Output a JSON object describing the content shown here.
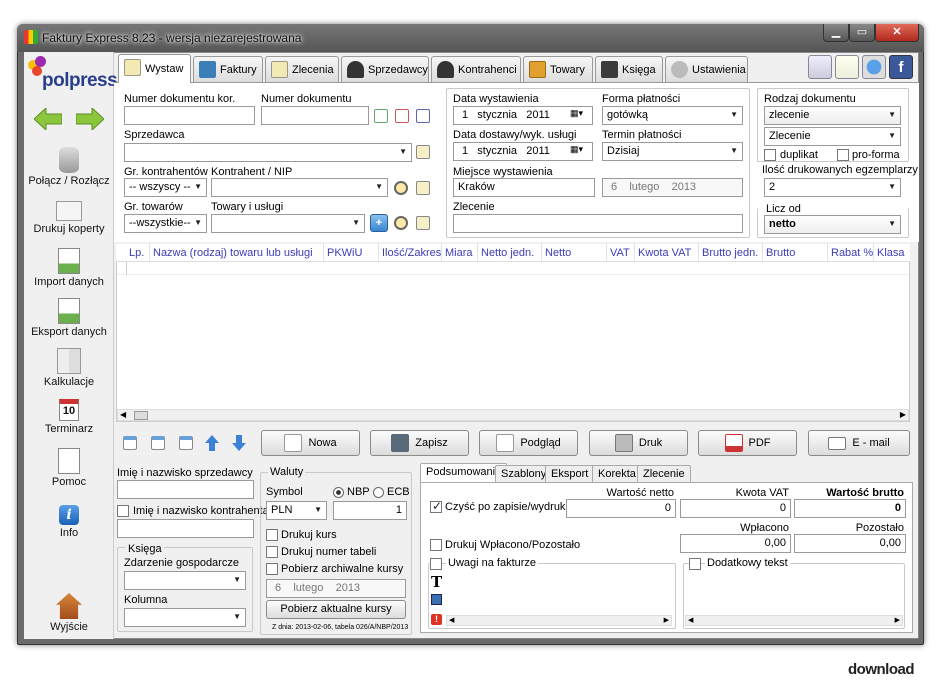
{
  "window": {
    "title": "Faktury Express 8.23 - wersja niezarejestrowana"
  },
  "brand": {
    "logo_text": "polpress"
  },
  "sidebar": {
    "items": [
      {
        "label": "Połącz / Rozłącz",
        "icon": "database-icon"
      },
      {
        "label": "Drukuj koperty",
        "icon": "envelope-icon"
      },
      {
        "label": "Import danych",
        "icon": "import-icon"
      },
      {
        "label": "Eksport danych",
        "icon": "export-icon"
      },
      {
        "label": "Kalkulacje",
        "icon": "calculator-icon"
      },
      {
        "label": "Terminarz",
        "icon": "calendar-icon",
        "badge": "10"
      },
      {
        "label": "Pomoc",
        "icon": "help-icon"
      },
      {
        "label": "Info",
        "icon": "info-icon",
        "glyph": "i"
      },
      {
        "label": "Wyjście",
        "icon": "exit-icon"
      }
    ]
  },
  "tabs": [
    {
      "label": "Wystaw"
    },
    {
      "label": "Faktury"
    },
    {
      "label": "Zlecenia"
    },
    {
      "label": "Sprzedawcy"
    },
    {
      "label": "Kontrahenci"
    },
    {
      "label": "Towary"
    },
    {
      "label": "Księga"
    },
    {
      "label": "Ustawienia"
    }
  ],
  "form": {
    "doc_kor_label": "Numer dokumentu kor.",
    "doc_num_label": "Numer dokumentu",
    "seller_label": "Sprzedawca",
    "contractor_group_label": "Gr. kontrahentów",
    "contractor_group_value": "-- wszyscy --",
    "contractor_label": "Kontrahent / NIP",
    "goods_group_label": "Gr. towarów",
    "goods_group_value": "--wszystkie--",
    "goods_label": "Towary i usługi",
    "issue_date_label": "Data wystawienia",
    "issue_date": {
      "day": "1",
      "month": "stycznia",
      "year": "2011"
    },
    "payment_form_label": "Forma płatności",
    "payment_form_value": "gotówką",
    "delivery_date_label": "Data dostawy/wyk. usługi",
    "delivery_date": {
      "day": "1",
      "month": "stycznia",
      "year": "2011"
    },
    "payment_term_label": "Termin płatności",
    "payment_term_value": "Dzisiaj",
    "place_label": "Miejsce wystawienia",
    "place_value": "Kraków",
    "place_date": {
      "day": "6",
      "month": "lutego",
      "year": "2013"
    },
    "order_label": "Zlecenie",
    "doc_type_label": "Rodzaj dokumentu",
    "doc_type_value": "zlecenie",
    "doc_type_value2": "Zlecenie",
    "duplicate_label": "duplikat",
    "proforma_label": "pro-forma",
    "copies_label": "Ilość drukowanych egzemplarzy",
    "copies_value": "2",
    "count_from_label": "Licz od",
    "count_from_value": "netto"
  },
  "grid": {
    "columns": [
      "Lp.",
      "Nazwa (rodzaj) towaru lub usługi",
      "PKWiU",
      "Ilość/Zakres",
      "Miara",
      "Netto jedn.",
      "Netto",
      "VAT",
      "Kwota VAT",
      "Brutto jedn.",
      "Brutto",
      "Rabat %",
      "Klasa"
    ]
  },
  "actions": {
    "new": "Nowa",
    "save": "Zapisz",
    "preview": "Podgląd",
    "print": "Druk",
    "pdf": "PDF",
    "email": "E - mail"
  },
  "bottom_left": {
    "seller_name_label": "Imię i nazwisko sprzedawcy",
    "contractor_name_label": "Imię i nazwisko kontrahenta",
    "book_legend": "Księga",
    "event_label": "Zdarzenie gospodarcze",
    "column_label": "Kolumna"
  },
  "currency": {
    "legend": "Waluty",
    "symbol_label": "Symbol",
    "symbol_value": "PLN",
    "nbp_label": "NBP",
    "ecb_label": "ECB",
    "rate_value": "1",
    "print_rate": "Drukuj kurs",
    "print_table": "Drukuj numer tabeli",
    "fetch_archive": "Pobierz archiwalne kursy",
    "archive_date": {
      "day": "6",
      "month": "lutego",
      "year": "2013"
    },
    "fetch_current": "Pobierz aktualne kursy",
    "footnote": "Z dnia: 2013-02-06, tabela 026/A/NBP/2013"
  },
  "summary": {
    "tabs": [
      "Podsumowanie",
      "Szablony",
      "Eksport",
      "Korekta",
      "Zlecenie"
    ],
    "clear_label": "Czyść po zapisie/wydruku",
    "net_label": "Wartość netto",
    "net_value": "0",
    "vat_label": "Kwota VAT",
    "vat_value": "0",
    "gross_label": "Wartość brutto",
    "gross_value": "0",
    "paid_label": "Wpłacono",
    "paid_value": "0,00",
    "remaining_label": "Pozostało",
    "remaining_value": "0,00",
    "print_paid_label": "Drukuj Wpłacono/Pozostało",
    "notes_label": "Uwagi na fakturze",
    "extra_text_label": "Dodatkowy tekst"
  },
  "watermark": "download"
}
